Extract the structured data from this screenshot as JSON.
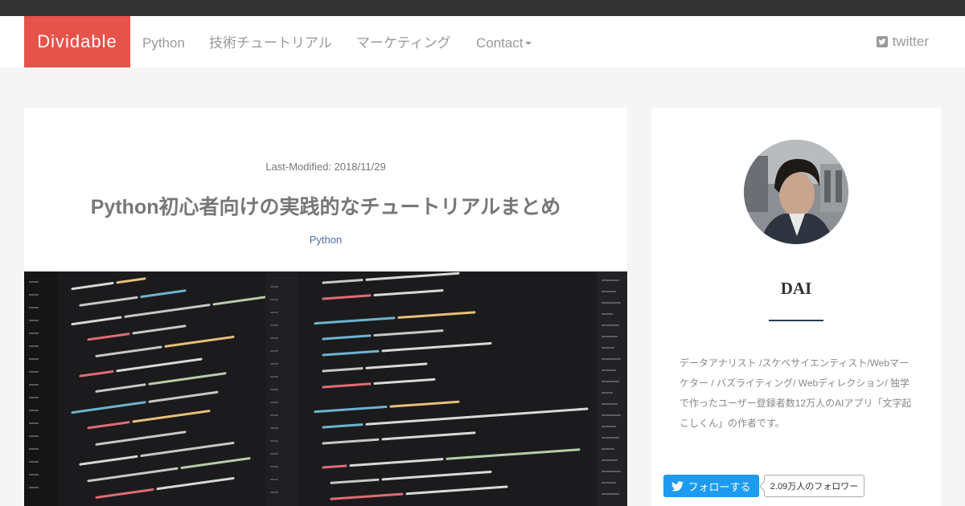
{
  "nav": {
    "brand": "Dividable",
    "items": [
      {
        "label": "Python"
      },
      {
        "label": "技術チュートリアル"
      },
      {
        "label": "マーケティング"
      },
      {
        "label": "Contact"
      }
    ],
    "twitter_label": "twitter"
  },
  "article": {
    "last_modified": "Last-Modified: 2018/11/29",
    "title": "Python初心者向けの実践的なチュートリアルまとめ",
    "category": "Python"
  },
  "sidebar": {
    "author_name": "DAI",
    "bio": "データアナリスト /スケベサイエンティスト/Webマーケター / バズライティング/ Webディレクション/ 独学で作ったユーザー登録者数12万人のAIアプリ「文字起こしくん」の作者です。",
    "follow_label": "フォローする",
    "follower_count": "2.09万人のフォロワー"
  },
  "colors": {
    "brand": "#e5534b",
    "topbar": "#333333",
    "link": "#4a6fa5",
    "twitter_blue": "#1d9bf0"
  },
  "icons": {
    "twitter": "twitter-square-icon",
    "twitter_bird": "twitter-bird-icon",
    "caret": "caret-down-icon"
  }
}
